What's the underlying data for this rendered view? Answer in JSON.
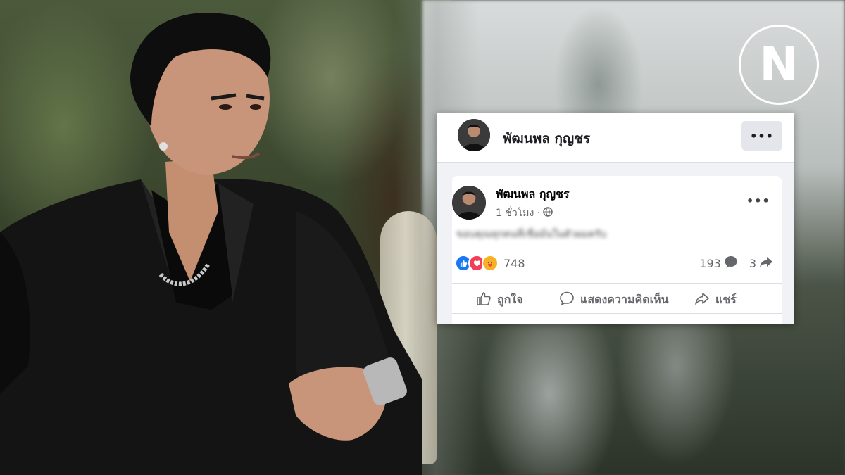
{
  "brand": {
    "logo_letter": "N"
  },
  "header": {
    "name": "พัฒนพล กุญชร",
    "more_label": "•••"
  },
  "post": {
    "author": "พัฒนพล กุญชร",
    "time": "1 ชั่วโมง ·",
    "privacy_icon": "globe-icon",
    "more_label": "•••",
    "message": "ขอบคุณทุกคนที่เชื่อมั่นในตัวผมครับ",
    "reactions": [
      "like",
      "love",
      "care"
    ],
    "reaction_count": "748",
    "comment_count": "193",
    "share_count": "3"
  },
  "actions": {
    "like_label": "ถูกใจ",
    "comment_label": "แสดงความคิดเห็น",
    "share_label": "แชร์"
  },
  "colors": {
    "like_blue": "#1877f2",
    "love_red": "#f33e58",
    "care_yellow": "#f7b125",
    "muted_text": "#65676b"
  }
}
